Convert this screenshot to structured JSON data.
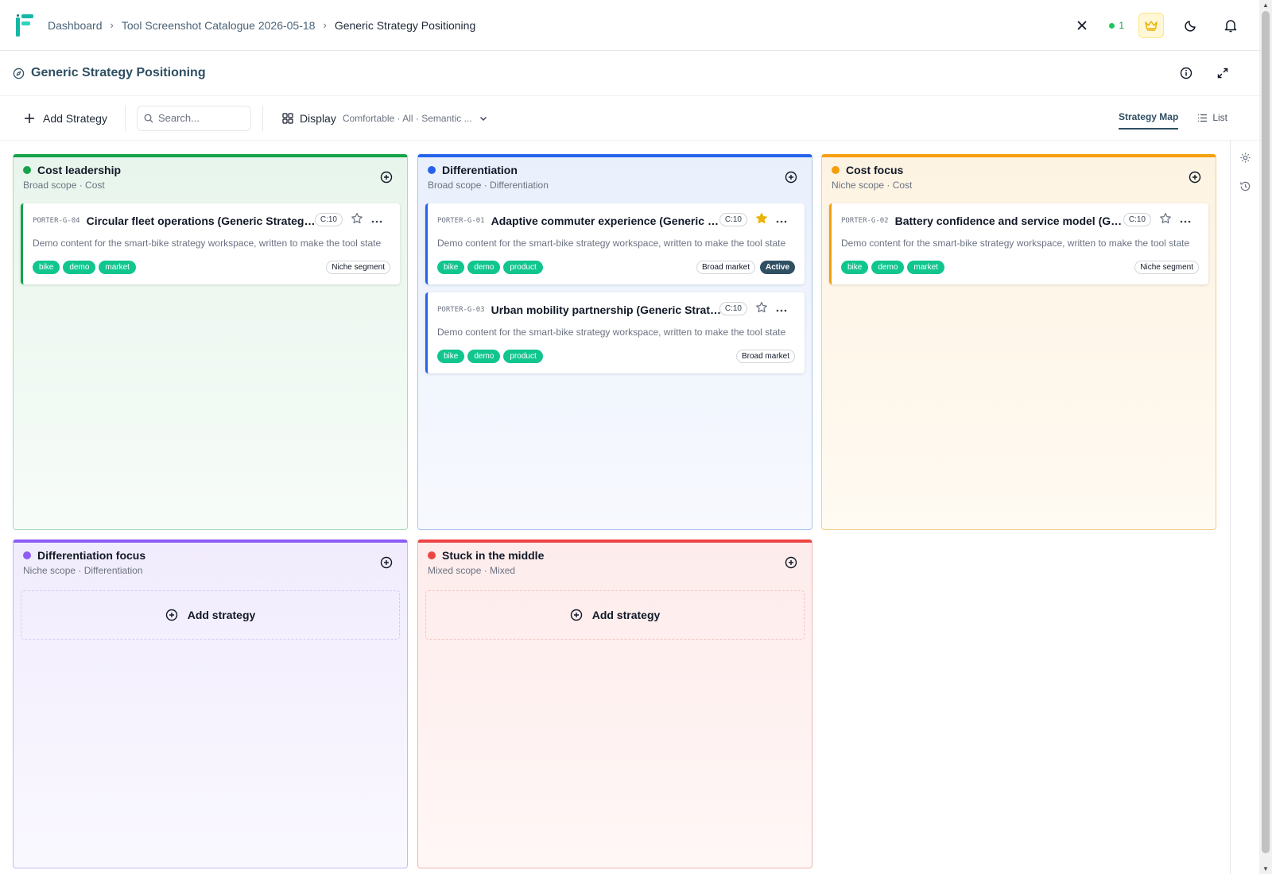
{
  "breadcrumb": {
    "items": [
      "Dashboard",
      "Tool Screenshot Catalogue 2026-05-18"
    ],
    "current": "Generic Strategy Positioning"
  },
  "header": {
    "online_count": "1"
  },
  "page": {
    "title": "Generic Strategy Positioning"
  },
  "toolbar": {
    "add_label": "Add Strategy",
    "search_placeholder": "Search...",
    "display_label": "Display",
    "display_meta": "Comfortable · All · Semantic ...",
    "views": [
      "Strategy Map",
      "List"
    ]
  },
  "columns": [
    {
      "title": "Cost leadership",
      "subtitle": "Broad scope · Cost",
      "color": "#16a34a",
      "cards": [
        {
          "code": "PORTER-G-04",
          "title": "Circular fleet operations (Generic Strategy ...",
          "count": "C:10",
          "starred": false,
          "desc": "Demo content for the smart-bike strategy workspace, written to make the tool state visible in catalogue screenshots.",
          "tags": [
            "bike",
            "demo",
            "market"
          ],
          "badges": [
            "Niche segment"
          ],
          "status": ""
        }
      ]
    },
    {
      "title": "Differentiation",
      "subtitle": "Broad scope · Differentiation",
      "color": "#2563eb",
      "cards": [
        {
          "code": "PORTER-G-01",
          "title": "Adaptive commuter experience (Generic St...",
          "count": "C:10",
          "starred": true,
          "desc": "Demo content for the smart-bike strategy workspace, written to make the tool state visible in catalogue screenshots.",
          "tags": [
            "bike",
            "demo",
            "product"
          ],
          "badges": [
            "Broad market"
          ],
          "status": "Active"
        },
        {
          "code": "PORTER-G-03",
          "title": "Urban mobility partnership (Generic Strate...",
          "count": "C:10",
          "starred": false,
          "desc": "Demo content for the smart-bike strategy workspace, written to make the tool state visible in catalogue screenshots.",
          "tags": [
            "bike",
            "demo",
            "product"
          ],
          "badges": [
            "Broad market"
          ],
          "status": ""
        }
      ]
    },
    {
      "title": "Cost focus",
      "subtitle": "Niche scope · Cost",
      "color": "#f59e0b",
      "cards": [
        {
          "code": "PORTER-G-02",
          "title": "Battery confidence and service model (Gen...",
          "count": "C:10",
          "starred": false,
          "desc": "Demo content for the smart-bike strategy workspace, written to make the tool state visible in catalogue screenshots.",
          "tags": [
            "bike",
            "demo",
            "market"
          ],
          "badges": [
            "Niche segment"
          ],
          "status": ""
        }
      ]
    },
    {
      "title": "Differentiation focus",
      "subtitle": "Niche scope · Differentiation",
      "color": "#8b5cf6",
      "cards": [],
      "empty_label": "Add strategy"
    },
    {
      "title": "Stuck in the middle",
      "subtitle": "Mixed scope · Mixed",
      "color": "#ef4444",
      "cards": [],
      "empty_label": "Add strategy"
    }
  ],
  "colors": {
    "accent": "#2f4f63",
    "tag": "#10c68e",
    "brand": "#14b8a6"
  }
}
